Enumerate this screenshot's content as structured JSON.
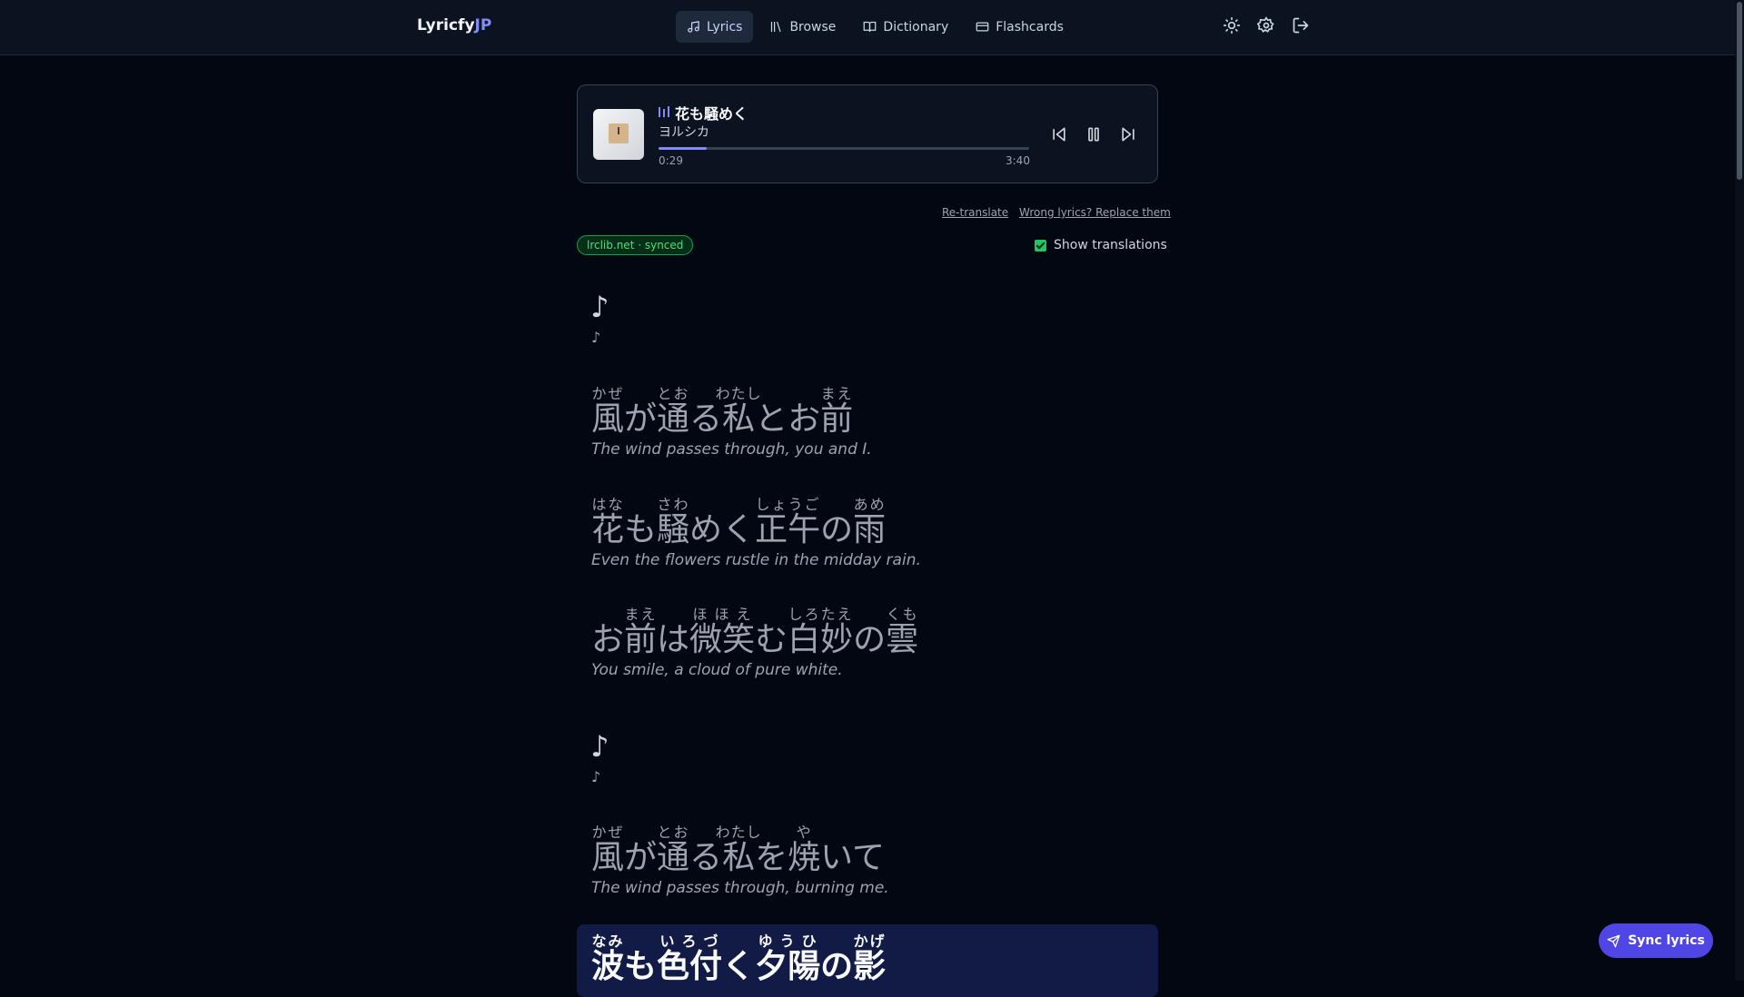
{
  "header": {
    "logo_main": "Lyricfy",
    "logo_accent": "JP",
    "nav": [
      {
        "label": "Lyrics",
        "icon": "music-note-icon",
        "active": true
      },
      {
        "label": "Browse",
        "icon": "library-icon",
        "active": false
      },
      {
        "label": "Dictionary",
        "icon": "book-icon",
        "active": false
      },
      {
        "label": "Flashcards",
        "icon": "cards-icon",
        "active": false
      }
    ],
    "icons": [
      "sun-icon",
      "gear-icon",
      "logout-icon"
    ]
  },
  "player": {
    "title": "花も騒めく",
    "artist": "ヨルシカ",
    "current_time": "0:29",
    "total_time": "3:40",
    "progress": 0.13
  },
  "actions": {
    "retranslate": "Re-translate",
    "replace": "Wrong lyrics? Replace them",
    "source_badge": "lrclib.net · synced",
    "show_translations": "Show translations"
  },
  "lyrics": {
    "note": "♪",
    "lines": [
      {
        "segments": [
          {
            "t": "風",
            "r": "かぜ"
          },
          {
            "t": "が"
          },
          {
            "t": "通",
            "r": "とお"
          },
          {
            "t": "る"
          },
          {
            "t": "私",
            "r": "わたし"
          },
          {
            "t": "とお"
          },
          {
            "t": "前",
            "r": "まえ"
          }
        ],
        "translation": "The wind passes through, you and I."
      },
      {
        "segments": [
          {
            "t": "花",
            "r": "はな"
          },
          {
            "t": "も"
          },
          {
            "t": "騒",
            "r": "さわ"
          },
          {
            "t": "めく"
          },
          {
            "t": "正午",
            "r": "しょうご"
          },
          {
            "t": "の"
          },
          {
            "t": "雨",
            "r": "あめ"
          }
        ],
        "translation": "Even the flowers rustle in the midday rain."
      },
      {
        "segments": [
          {
            "t": "お"
          },
          {
            "t": "前",
            "r": "まえ"
          },
          {
            "t": "は"
          },
          {
            "t": "微笑",
            "r": "ほほえ"
          },
          {
            "t": "む"
          },
          {
            "t": "白妙",
            "r": "しろたえ"
          },
          {
            "t": "の"
          },
          {
            "t": "雲",
            "r": "くも"
          }
        ],
        "translation": "You smile, a cloud of pure white."
      },
      {
        "segments": [
          {
            "t": "風",
            "r": "かぜ"
          },
          {
            "t": "が"
          },
          {
            "t": "通",
            "r": "とお"
          },
          {
            "t": "る"
          },
          {
            "t": "私",
            "r": "わたし"
          },
          {
            "t": "を"
          },
          {
            "t": "焼",
            "r": "や"
          },
          {
            "t": "いて"
          }
        ],
        "translation": "The wind passes through, burning me."
      },
      {
        "segments": [
          {
            "t": "波",
            "r": "なみ"
          },
          {
            "t": "も"
          },
          {
            "t": "色付",
            "r": "いろづ"
          },
          {
            "t": "く"
          },
          {
            "t": "夕陽",
            "r": "ゆうひ"
          },
          {
            "t": "の"
          },
          {
            "t": "影",
            "r": "かげ"
          }
        ],
        "translation": ""
      }
    ]
  },
  "sync_button": "Sync lyrics",
  "colors": {
    "accent": "#818cf8",
    "badge_green": "#4ade80",
    "button": "#4f46e5",
    "background": "#030712"
  }
}
